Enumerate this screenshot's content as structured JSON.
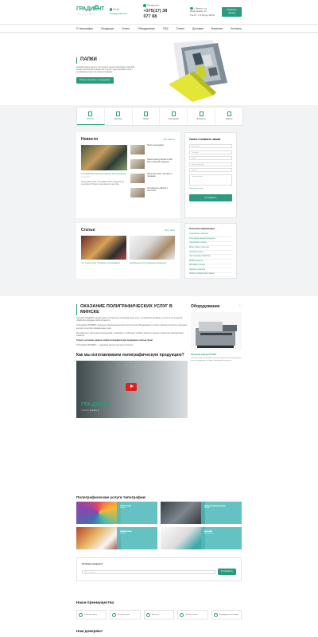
{
  "header": {
    "logo_main": "ГРАДИЕНТ",
    "logo_sub": "типография",
    "email_label": "Email",
    "email": "info@gradient.by",
    "phone_label": "Телефоны",
    "phone": "+375(17) 38 077 88",
    "address": "г. Минск, ул. Бабушкина, 64",
    "schedule": "Пн-Пт: с 9:00 до 18:00",
    "callback_button": "Заказать звонок"
  },
  "nav": [
    "О типографии",
    "Продукция",
    "Услуги",
    "Оборудование",
    "FAQ",
    "Статьи",
    "Доставка",
    "Вакансии",
    "Контакты"
  ],
  "hero": {
    "title": "ПАПКИ",
    "description": "Корпоративные папки с логотипом в нашей типографии. Широкий выбор материалов и вариантов отделки, качественная печать и оперативные сроки изготовления заказа.",
    "button": "Узнать больше о продукции"
  },
  "categories": [
    "Визитки",
    "Буклеты",
    "Папки",
    "Календари",
    "Блокноты",
    "Пакеты"
  ],
  "news": {
    "title": "Новости",
    "all_link": "Все новости",
    "main": {
      "caption": "Ультрабелая бумага в нашем ассортименте",
      "date": "12.04.2021",
      "text": "Предлагаем заказ полиграфической продукции на ультрабелой бумаге премиального качества."
    },
    "items": [
      {
        "title": "Печать календарей"
      },
      {
        "title": "Новый принтер Mimaki JV150-160 в печатной продукции"
      },
      {
        "title": "Офсетная печать под заказ и тиражами"
      },
      {
        "title": "Изготовление наборов с логотипом"
      }
    ]
  },
  "form": {
    "title": "Узнать стоимость заказа",
    "fields": [
      "Ваше имя",
      "Телефон",
      "Email",
      "Вид продукции",
      "Тираж",
      "Комментарий"
    ],
    "attach": "Прикрепить файл",
    "button": "Отправить"
  },
  "articles": {
    "title": "Статьи",
    "all_link": "Все статьи",
    "items": [
      {
        "caption": "Что такое книга, обложка и типографика"
      },
      {
        "caption": "Особенности изготовления продукции"
      }
    ]
  },
  "useful": {
    "title": "Полезная информация",
    "items": [
      "Требования к макетам",
      "Конструкция вашей продукции",
      "Подготовка к печати",
      "Виды бумаги и картона",
      "Способы печати",
      "Постпечатная обработка",
      "Дизайн макетов",
      "Доставка и оплата",
      "Гарантии качества",
      "Правила оформления заказа"
    ]
  },
  "about": {
    "title": "ОКАЗАНИЕ ПОЛИГРАФИЧЕСКИХ УСЛУГ В МИНСКЕ",
    "paragraphs": [
      "Компания ГРАДИЕНТ предоставляет полный цикл полиграфических услуг: от разработки дизайна до печати и постпечатной обработки продукции любой сложности.",
      "Типография ГРАДИЕНТ оснащена современным высокотехнологичным оборудованием, которое позволяет выпускать продукцию высокого качества в минимальные сроки.",
      "Мы работаем с различными материалами и тиражами, от небольших пробных партий до крупных заказов для корпоративных клиентов.",
      "Типография ГРАДИЕНТ — надёжный партнёр для вашего бизнеса."
    ],
    "bold_text": "Только у нас можно заказать любую полиграфическую продукцию в сжатые сроки!"
  },
  "video": {
    "title": "Как мы изготавливаем полиграфическую продукцию?",
    "logo_main": "ГРАДИЕНТ",
    "logo_sub": "типография"
  },
  "equipment": {
    "title": "Оборудование",
    "name": "Печатная машина RYOBI",
    "description": "Печатная машина RYOBI позволяет выполнять полноцветную печать продукции на бумаге различной плотности."
  },
  "services": {
    "title": "Полиграфические услуги типографии:",
    "items": [
      {
        "name": "Офсетная",
        "sub": "печать"
      },
      {
        "name": "Широкоформатная",
        "sub": "печать"
      },
      {
        "name": "Цифровая",
        "sub": "печать"
      },
      {
        "name": "Дизайн",
        "sub": "продукции"
      }
    ]
  },
  "cta": {
    "title": "Остались вопросы?",
    "placeholder": "Ваш телефон",
    "button": "Отправить"
  },
  "advantages": {
    "title": "Наши преимущества",
    "items": [
      "Качество печати",
      "Быстрые сроки",
      "Доставка",
      "Удобная оплата",
      "Индивидуальный подход"
    ]
  },
  "trust": {
    "title": "Нам доверяют"
  },
  "colors": {
    "accent": "#2b9b7e",
    "teal": "#50b9b9"
  }
}
